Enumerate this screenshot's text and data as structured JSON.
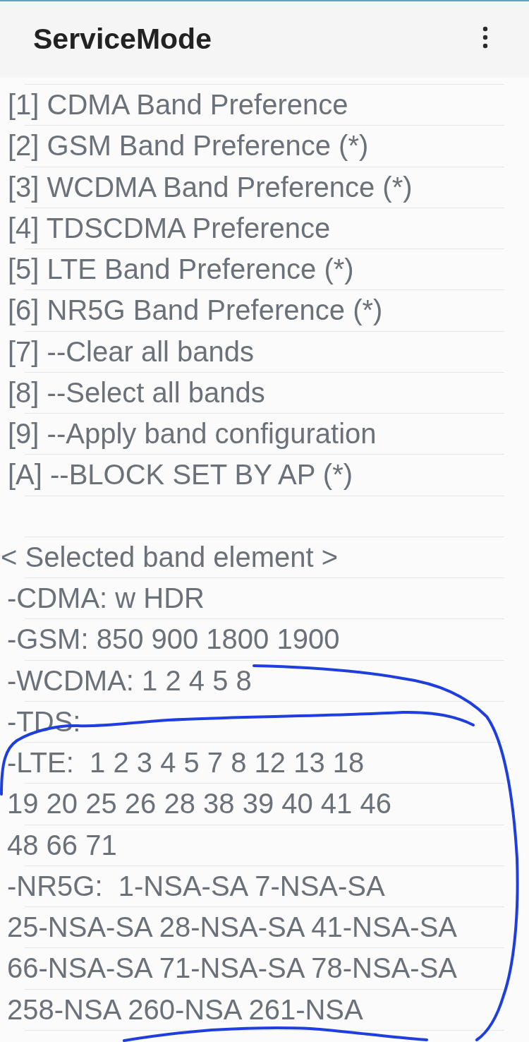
{
  "app_bar": {
    "title": "ServiceMode"
  },
  "annotation": {
    "kind": "freehand-loop"
  },
  "lines": [
    {
      "kind": "option",
      "text": "[1] CDMA Band Preference"
    },
    {
      "kind": "option",
      "text": "[2] GSM Band Preference (*)"
    },
    {
      "kind": "option",
      "text": "[3] WCDMA Band Preference (*)"
    },
    {
      "kind": "option",
      "text": "[4] TDSCDMA Preference"
    },
    {
      "kind": "option",
      "text": "[5] LTE Band Preference (*)"
    },
    {
      "kind": "option",
      "text": "[6] NR5G Band Preference (*)"
    },
    {
      "kind": "option",
      "text": "[7] --Clear all bands"
    },
    {
      "kind": "option",
      "text": "[8] --Select all bands"
    },
    {
      "kind": "option",
      "text": "[9] --Apply band configuration"
    },
    {
      "kind": "option",
      "text": "[A] --BLOCK SET BY AP (*)"
    },
    {
      "kind": "blank"
    },
    {
      "kind": "heading",
      "text": "< Selected band element >"
    },
    {
      "kind": "info",
      "text": "-CDMA: w HDR"
    },
    {
      "kind": "info",
      "text": "-GSM: 850 900 1800 1900"
    },
    {
      "kind": "info",
      "text": "-WCDMA: 1 2 4 5 8"
    },
    {
      "kind": "info",
      "text": "-TDS:"
    },
    {
      "kind": "info",
      "text": "-LTE:  1 2 3 4 5 7 8 12 13 18"
    },
    {
      "kind": "info",
      "text": "19 20 25 26 28 38 39 40 41 46"
    },
    {
      "kind": "info",
      "text": "48 66 71"
    },
    {
      "kind": "info",
      "text": "-NR5G:  1-NSA-SA 7-NSA-SA"
    },
    {
      "kind": "info",
      "text": "25-NSA-SA 28-NSA-SA 41-NSA-SA"
    },
    {
      "kind": "info",
      "text": "66-NSA-SA 71-NSA-SA 78-NSA-SA"
    },
    {
      "kind": "info",
      "text": "258-NSA 260-NSA 261-NSA"
    }
  ]
}
